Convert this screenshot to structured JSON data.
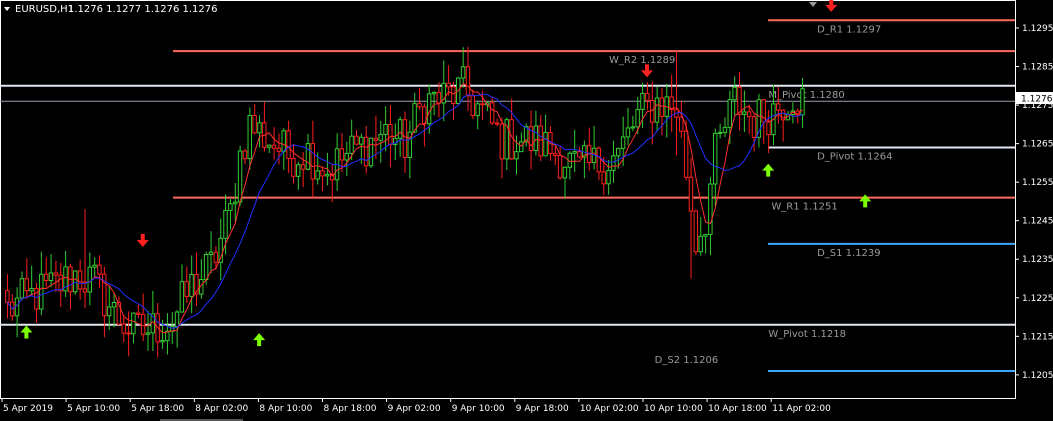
{
  "header": {
    "symbol": "EURUSD,H1",
    "ohlc": "1.1276 1.1277 1.1276 1.1276"
  },
  "colors": {
    "background": "#000000",
    "axis": "#ffffff",
    "bull": "#32cd32",
    "bear": "#ff1e1e",
    "ma_fast": "#ff3030",
    "ma_slow": "#2030ff",
    "resistance": "#ff6a5c",
    "support": "#3ca8ff",
    "pivot": "#e0e8f0",
    "arrow_up": "#7cff00",
    "arrow_down": "#ff2020",
    "bid_line": "#9aa0b0",
    "label": "#9a9a9a"
  },
  "current_price_label": "1.1276",
  "chart_data": {
    "type": "candlestick",
    "title": "EURUSD,H1",
    "ylim": [
      1.1199,
      1.1302
    ],
    "y_ticks": [
      "1.1295",
      "1.1285",
      "1.1275",
      "1.1265",
      "1.1255",
      "1.1245",
      "1.1235",
      "1.1225",
      "1.1215",
      "1.1205"
    ],
    "x_tick_labels": [
      "5 Apr 2019",
      "5 Apr 10:00",
      "5 Apr 18:00",
      "8 Apr 02:00",
      "8 Apr 10:00",
      "8 Apr 18:00",
      "9 Apr 02:00",
      "9 Apr 10:00",
      "9 Apr 18:00",
      "10 Apr 02:00",
      "10 Apr 10:00",
      "10 Apr 18:00",
      "11 Apr 02:00"
    ],
    "candle_anchors": [
      [
        0,
        1.1222
      ],
      [
        6,
        1.1226
      ],
      [
        10,
        1.1228
      ],
      [
        14,
        1.1231
      ],
      [
        18,
        1.1229
      ],
      [
        22,
        1.1221
      ],
      [
        26,
        1.1216
      ],
      [
        30,
        1.1217
      ],
      [
        34,
        1.1219
      ],
      [
        38,
        1.1228
      ],
      [
        42,
        1.1233
      ],
      [
        46,
        1.1247
      ],
      [
        48,
        1.1262
      ],
      [
        50,
        1.127
      ],
      [
        54,
        1.1266
      ],
      [
        58,
        1.1262
      ],
      [
        62,
        1.1263
      ],
      [
        66,
        1.1258
      ],
      [
        70,
        1.1262
      ],
      [
        74,
        1.1265
      ],
      [
        78,
        1.1268
      ],
      [
        82,
        1.1265
      ],
      [
        86,
        1.1276
      ],
      [
        90,
        1.1277
      ],
      [
        94,
        1.1279
      ],
      [
        98,
        1.1273
      ],
      [
        102,
        1.1266
      ],
      [
        106,
        1.1266
      ],
      [
        110,
        1.1265
      ],
      [
        114,
        1.1262
      ],
      [
        118,
        1.1258
      ],
      [
        122,
        1.126
      ],
      [
        126,
        1.1262
      ],
      [
        130,
        1.1272
      ],
      [
        134,
        1.1276
      ],
      [
        138,
        1.1274
      ],
      [
        140,
        1.1258
      ],
      [
        142,
        1.124
      ],
      [
        144,
        1.1246
      ],
      [
        146,
        1.1262
      ],
      [
        150,
        1.1276
      ],
      [
        154,
        1.1271
      ],
      [
        158,
        1.1274
      ],
      [
        162,
        1.1278
      ],
      [
        164,
        1.1276
      ]
    ],
    "candle_count": 165,
    "spikes": [
      [
        16,
        1.1248,
        1.1232
      ],
      [
        138,
        1.1289,
        1.1262
      ],
      [
        141,
        1.1252,
        1.123
      ]
    ],
    "levels": [
      {
        "name": "D_R1 1.1297",
        "value": 1.1297,
        "x_start": 0.7567,
        "label_x": 0.805,
        "label_pos": "below",
        "kind": "resistance"
      },
      {
        "name": "W_R2 1.1289",
        "value": 1.1289,
        "x_start": 0.1705,
        "label_x": 0.6,
        "label_pos": "below",
        "kind": "resistance"
      },
      {
        "name": "M_Pivot 1.1280",
        "value": 1.128,
        "x_start": 0.0,
        "label_x": 0.757,
        "label_pos": "below",
        "kind": "pivot"
      },
      {
        "name": "D_Pivot 1.1264",
        "value": 1.1264,
        "x_start": 0.7567,
        "label_x": 0.805,
        "label_pos": "below",
        "kind": "pivot"
      },
      {
        "name": "W_R1 1.1251",
        "value": 1.1251,
        "x_start": 0.1705,
        "label_x": 0.76,
        "label_pos": "below",
        "kind": "resistance"
      },
      {
        "name": "D_S1 1.1239",
        "value": 1.1239,
        "x_start": 0.7567,
        "label_x": 0.805,
        "label_pos": "below",
        "kind": "support"
      },
      {
        "name": "W_Pivot 1.1218",
        "value": 1.1218,
        "x_start": 0.0,
        "label_x": 0.757,
        "label_pos": "below",
        "kind": "pivot"
      },
      {
        "name": "D_S2 1.1206",
        "value": 1.1206,
        "x_start": 0.7567,
        "label_x": 0.645,
        "label_pos": "above",
        "kind": "support"
      }
    ],
    "signals": [
      {
        "type": "up",
        "candle": 4,
        "price": 1.1216
      },
      {
        "type": "down",
        "candle": 28,
        "price": 1.124
      },
      {
        "type": "up",
        "candle": 52,
        "price": 1.1214
      },
      {
        "type": "down",
        "candle": 132,
        "price": 1.1284
      },
      {
        "type": "down",
        "candle": 170,
        "price": 1.1301
      },
      {
        "type": "up",
        "candle": 157,
        "price": 1.1258
      },
      {
        "type": "up",
        "candle": 177,
        "price": 1.125
      }
    ]
  }
}
